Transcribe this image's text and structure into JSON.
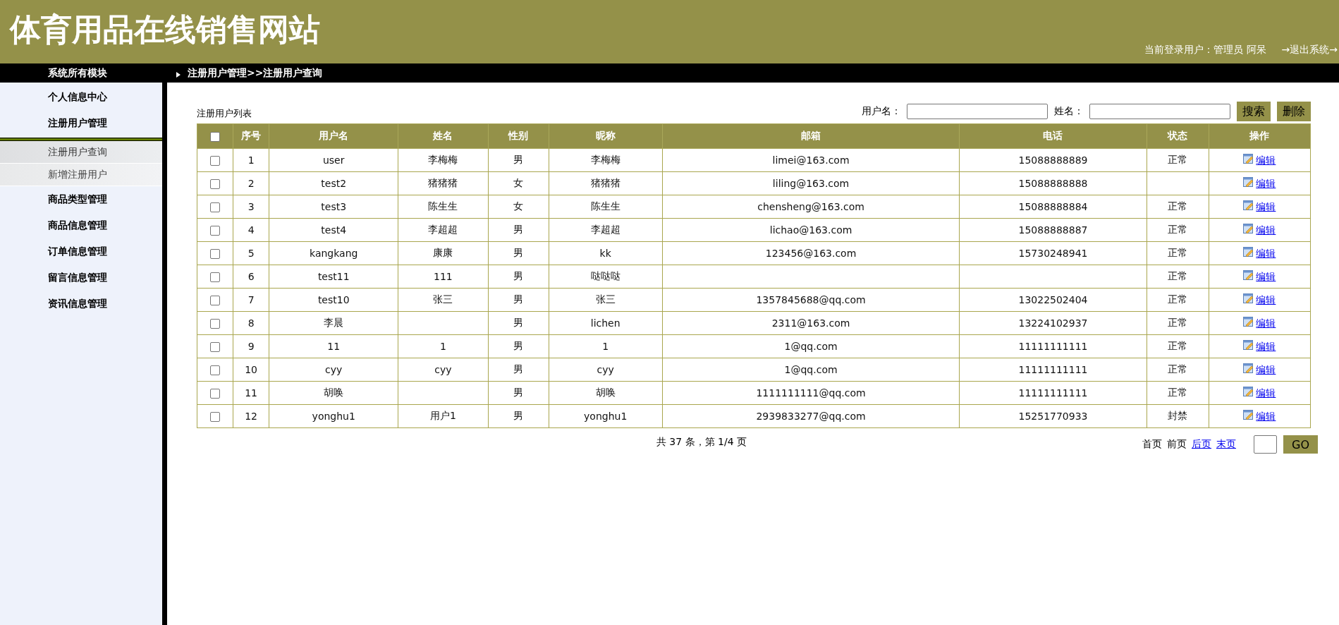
{
  "site_title": "体育用品在线销售网站",
  "user_info": "当前登录用户：管理员 阿呆",
  "logout": "→退出系统→",
  "sidebar": {
    "title": "系统所有模块",
    "items": [
      {
        "label": "个人信息中心",
        "kind": "module"
      },
      {
        "label": "注册用户管理",
        "kind": "module"
      },
      {
        "kind": "divider"
      },
      {
        "label": "注册用户查询",
        "kind": "sub",
        "selected": true
      },
      {
        "label": "新增注册用户",
        "kind": "sub",
        "selected": false
      },
      {
        "label": "商品类型管理",
        "kind": "module"
      },
      {
        "label": "商品信息管理",
        "kind": "module"
      },
      {
        "label": "订单信息管理",
        "kind": "module"
      },
      {
        "label": "留言信息管理",
        "kind": "module"
      },
      {
        "label": "资讯信息管理",
        "kind": "module"
      }
    ]
  },
  "breadcrumb": "注册用户管理>>注册用户查询",
  "list_title": "注册用户列表",
  "search": {
    "fields": [
      {
        "label": "用户名："
      },
      {
        "label": "姓名："
      }
    ],
    "buttons": [
      "搜索",
      "删除"
    ]
  },
  "table": {
    "select_all_checked": false,
    "columns": [
      "序号",
      "用户名",
      "姓名",
      "性别",
      "昵称",
      "邮箱",
      "电话",
      "状态",
      "操作"
    ],
    "rows": [
      {
        "checked": false,
        "cells": [
          "1",
          "user",
          "李梅梅",
          "男",
          "李梅梅",
          "limei@163.com",
          "15088888889",
          "正常"
        ],
        "action": "编辑"
      },
      {
        "checked": false,
        "cells": [
          "2",
          "test2",
          "猪猪猪",
          "女",
          "猪猪猪",
          "liling@163.com",
          "15088888888",
          ""
        ],
        "action": "编辑"
      },
      {
        "checked": false,
        "cells": [
          "3",
          "test3",
          "陈生生",
          "女",
          "陈生生",
          "chensheng@163.com",
          "15088888884",
          "正常"
        ],
        "action": "编辑"
      },
      {
        "checked": false,
        "cells": [
          "4",
          "test4",
          "李超超",
          "男",
          "李超超",
          "lichao@163.com",
          "15088888887",
          "正常"
        ],
        "action": "编辑"
      },
      {
        "checked": false,
        "cells": [
          "5",
          "kangkang",
          "康康",
          "男",
          "kk",
          "123456@163.com",
          "15730248941",
          "正常"
        ],
        "action": "编辑"
      },
      {
        "checked": false,
        "cells": [
          "6",
          "test11",
          "111",
          "男",
          "哒哒哒",
          "",
          "",
          "正常"
        ],
        "action": "编辑"
      },
      {
        "checked": false,
        "cells": [
          "7",
          "test10",
          "张三",
          "男",
          "张三",
          "1357845688@qq.com",
          "13022502404",
          "正常"
        ],
        "action": "编辑"
      },
      {
        "checked": false,
        "cells": [
          "8",
          "李晨",
          "",
          "男",
          "lichen",
          "2311@163.com",
          "13224102937",
          "正常"
        ],
        "action": "编辑"
      },
      {
        "checked": false,
        "cells": [
          "9",
          "11",
          "1",
          "男",
          "1",
          "1@qq.com",
          "11111111111",
          "正常"
        ],
        "action": "编辑"
      },
      {
        "checked": false,
        "cells": [
          "10",
          "cyy",
          "cyy",
          "男",
          "cyy",
          "1@qq.com",
          "11111111111",
          "正常"
        ],
        "action": "编辑"
      },
      {
        "checked": false,
        "cells": [
          "11",
          "胡唤",
          "",
          "男",
          "胡唤",
          "1111111111@qq.com",
          "11111111111",
          "正常"
        ],
        "action": "编辑"
      },
      {
        "checked": false,
        "cells": [
          "12",
          "yonghu1",
          "用户1",
          "男",
          "yonghu1",
          "2939833277@qq.com",
          "15251770933",
          "封禁"
        ],
        "action": "编辑"
      }
    ]
  },
  "pagination": {
    "summary": "共 37 条，第 1/4 页",
    "links": [
      {
        "label": "首页",
        "kind": "text"
      },
      {
        "label": "前页",
        "kind": "text"
      },
      {
        "label": "后页",
        "kind": "link"
      },
      {
        "label": "末页",
        "kind": "link"
      }
    ],
    "go": "GO"
  }
}
